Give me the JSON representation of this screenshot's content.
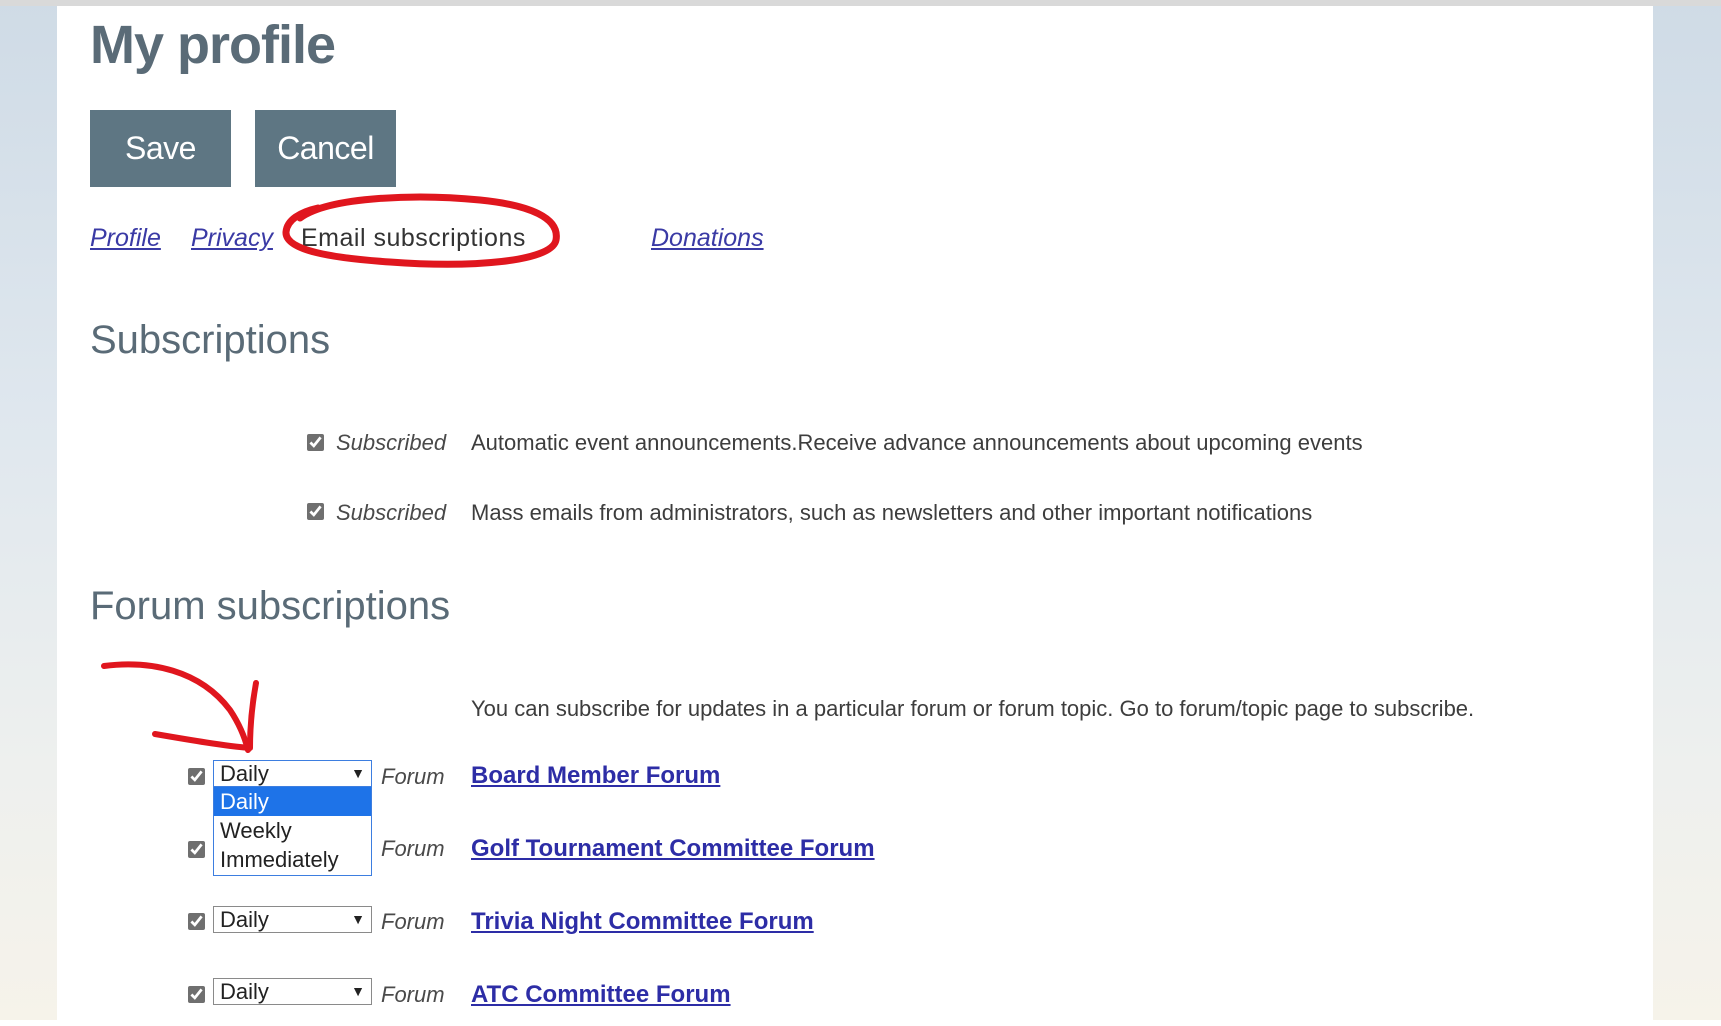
{
  "page": {
    "title": "My profile",
    "save_label": "Save",
    "cancel_label": "Cancel"
  },
  "tabs": {
    "profile": "Profile",
    "privacy": "Privacy",
    "email_subscriptions": "Email subscriptions",
    "donations": "Donations"
  },
  "subscriptions": {
    "heading": "Subscriptions",
    "items": [
      {
        "checked": true,
        "label": "Subscribed",
        "description": "Automatic event announcements.Receive advance announcements about upcoming events"
      },
      {
        "checked": true,
        "label": "Subscribed",
        "description": "Mass emails from administrators, such as newsletters and other important notifications"
      }
    ]
  },
  "forum": {
    "heading": "Forum subscriptions",
    "info": "You can subscribe for updates in a particular forum or forum topic. Go to forum/topic page to subscribe.",
    "label": "Forum",
    "options": [
      "Daily",
      "Weekly",
      "Immediately"
    ],
    "items": [
      {
        "checked": true,
        "frequency": "Daily",
        "name": "Board Member Forum",
        "dropdown_open": true
      },
      {
        "checked": true,
        "frequency": "Daily",
        "name": "Golf Tournament Committee Forum"
      },
      {
        "checked": true,
        "frequency": "Daily",
        "name": "Trivia Night Committee Forum"
      },
      {
        "checked": true,
        "frequency": "Daily",
        "name": "ATC Committee Forum"
      }
    ]
  },
  "colors": {
    "button_bg": "#5e7683",
    "heading": "#5a6b77",
    "link": "#2d2da6",
    "annotation": "#e0161e",
    "dropdown_highlight": "#1e73e8"
  }
}
